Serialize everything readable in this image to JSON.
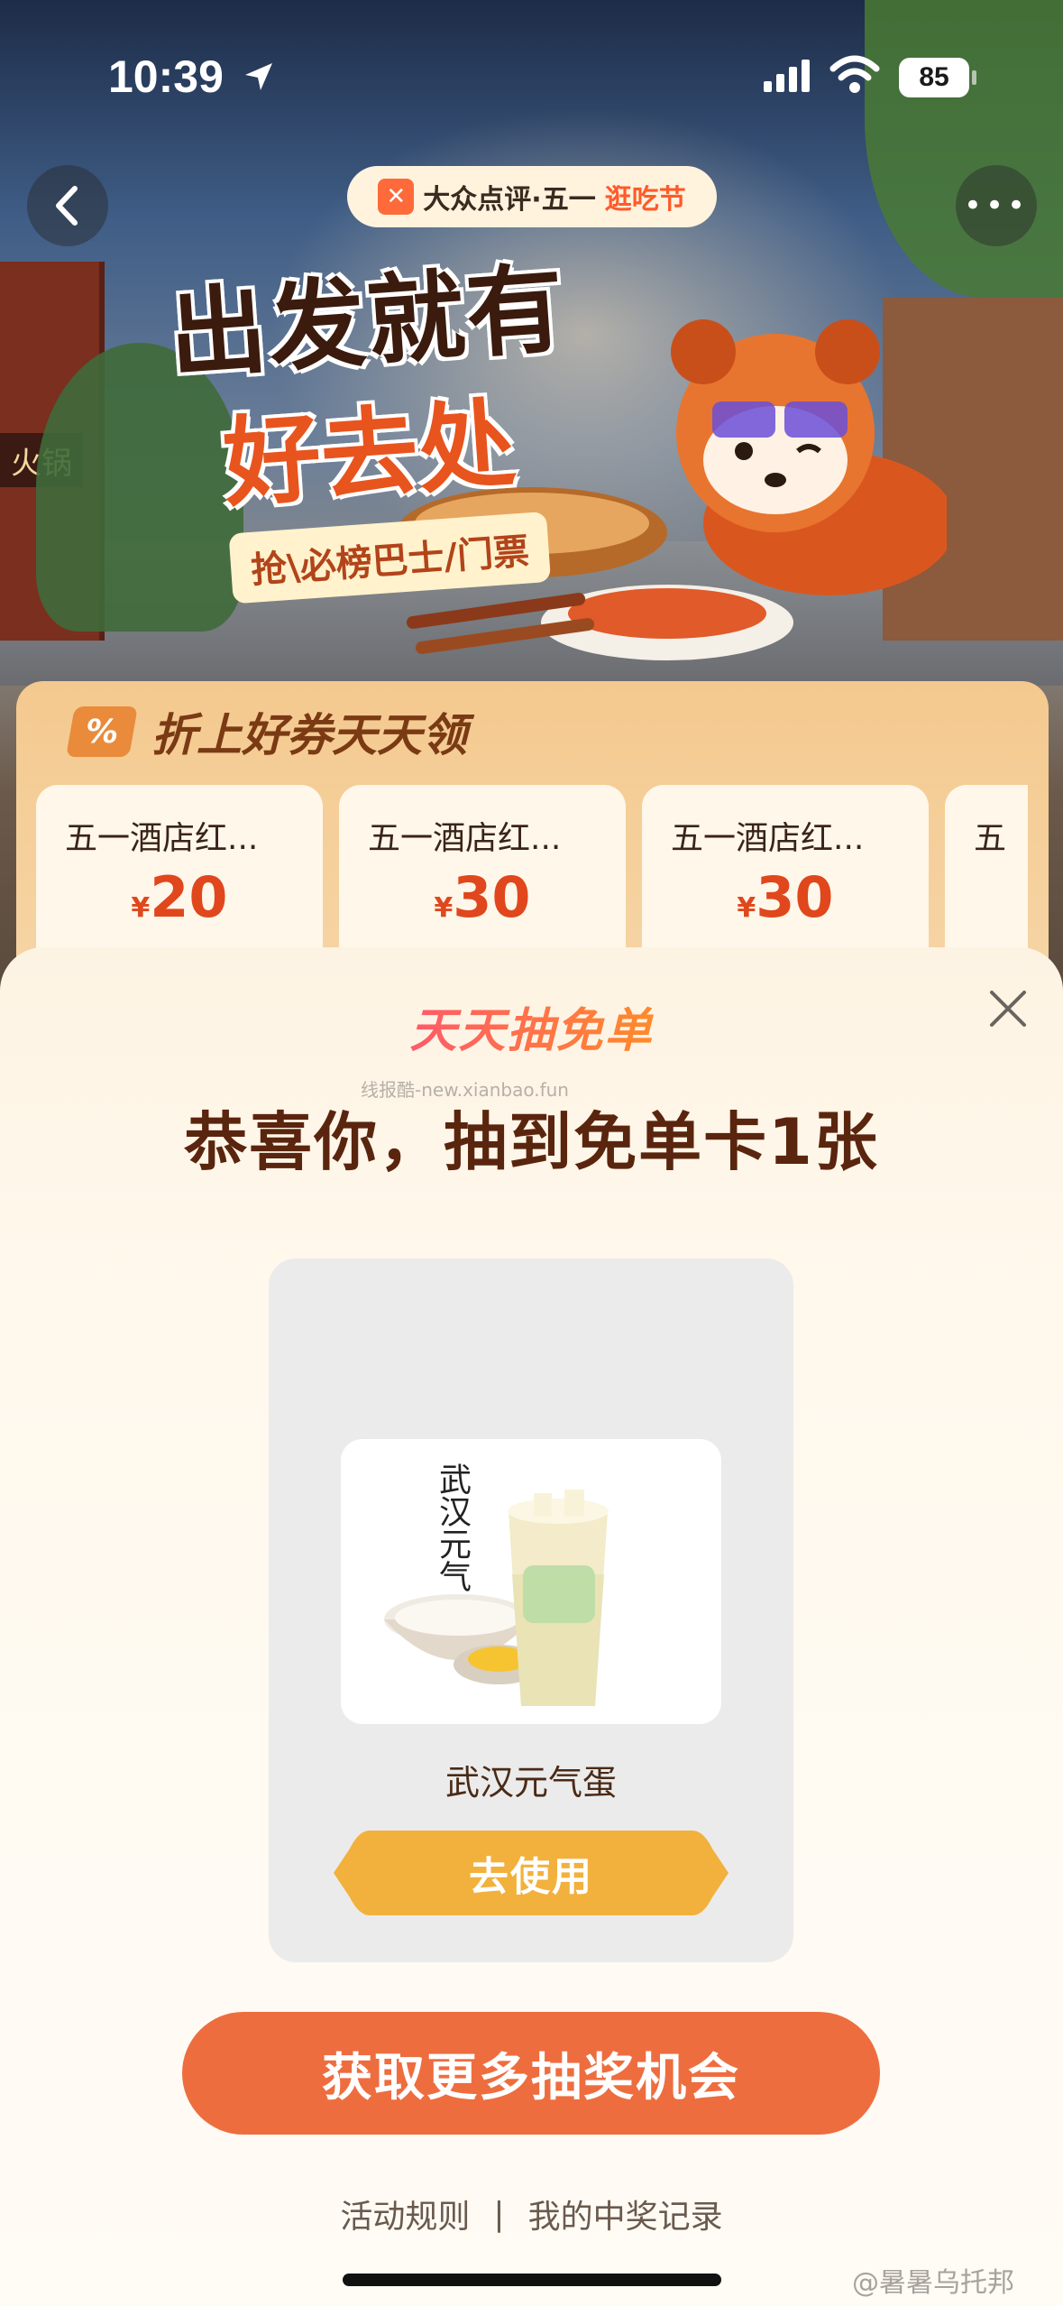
{
  "status_bar": {
    "time": "10:39",
    "battery": "85"
  },
  "hero": {
    "brand_name": "大众点评·五一",
    "brand_highlight": "逛吃节",
    "title_line1": "出发就有",
    "title_line2": "好去处",
    "subtitle": "抢\\必榜巴士/门票",
    "shop_sign": "火锅"
  },
  "coupon_section": {
    "badge": "%",
    "title": "折上好券天天领",
    "coupons": [
      {
        "title": "五一酒店红...",
        "currency": "¥",
        "amount": "20"
      },
      {
        "title": "五一酒店红...",
        "currency": "¥",
        "amount": "30"
      },
      {
        "title": "五一酒店红...",
        "currency": "¥",
        "amount": "30"
      },
      {
        "title": "五",
        "currency": "",
        "amount": ""
      }
    ]
  },
  "modal": {
    "logo": "天天抽免单",
    "watermark": "线报酷-new.xianbao.fun",
    "headline": "恭喜你，抽到免单卡1张",
    "prize": {
      "image_text": "武汉元气蛋",
      "name": "武汉元气蛋",
      "use_button": "去使用"
    },
    "more_button": "获取更多抽奖机会",
    "links": {
      "rules": "活动规则",
      "separator": "|",
      "records": "我的中奖记录"
    }
  },
  "credit": "@暑暑乌托邦",
  "colors": {
    "accent_orange": "#ee6d3f",
    "use_button_yellow": "#f2b13c",
    "headline_brown": "#5a250e",
    "coupon_red": "#e0471d"
  }
}
